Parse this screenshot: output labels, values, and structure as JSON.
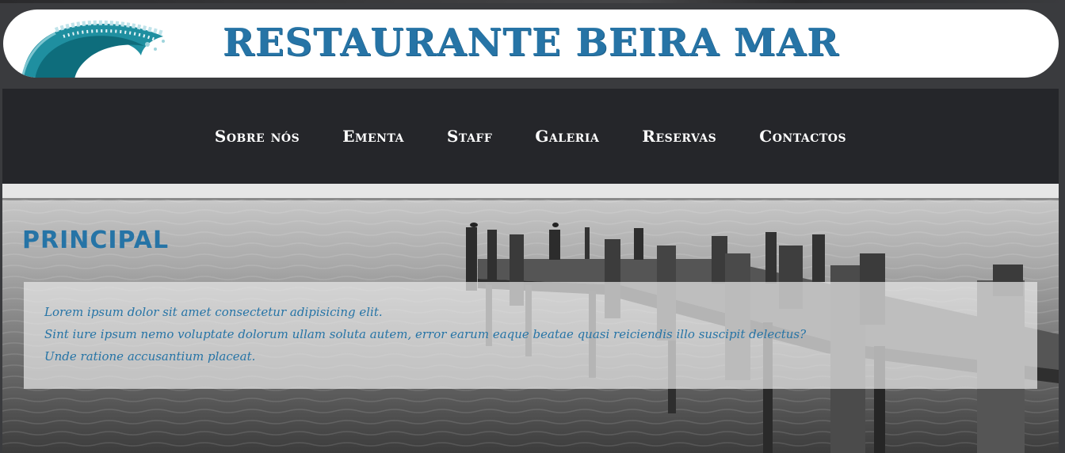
{
  "header": {
    "title": "RESTAURANTE BEIRA MAR",
    "logo_icon": "wave-icon"
  },
  "nav": {
    "items": [
      {
        "label": "Sobre nós"
      },
      {
        "label": "Ementa"
      },
      {
        "label": "Staff"
      },
      {
        "label": "Galeria"
      },
      {
        "label": "Reservas"
      },
      {
        "label": "Contactos"
      }
    ]
  },
  "main": {
    "section_title": "PRINCIPAL",
    "lines": [
      "Lorem ipsum dolor sit amet consectetur adipisicing elit.",
      "Sint iure ipsum nemo voluptate dolorum ullam soluta autem, error earum eaque beatae quasi reiciendis illo suscipit delectus?",
      "Unde ratione accusantium placeat."
    ]
  },
  "colors": {
    "accent": "#2674a6",
    "nav_bg": "#25262a",
    "page_bg": "#3a3b3e"
  }
}
